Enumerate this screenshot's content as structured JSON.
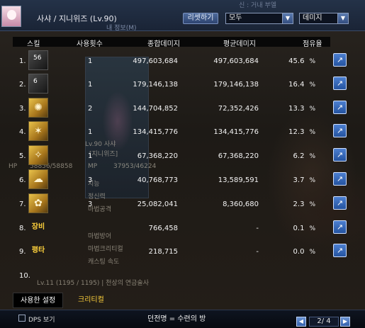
{
  "window": {
    "character_name": "사샤 / 지니위즈 (Lv.90)",
    "subtitle": "내 정보(M)",
    "top_hint": "신 : 거내 부엘",
    "reset_label": "리셋하기",
    "filter_dropdown": "모두",
    "metric_dropdown": "데미지"
  },
  "columns": {
    "skill": "스킬",
    "uses": "사용횟수",
    "total": "종합데미지",
    "average": "평균데미지",
    "share": "점유율"
  },
  "rows": [
    {
      "num": "1.",
      "icon": "skill-icon-1",
      "level": "56",
      "uses": "1",
      "total": "497,603,684",
      "average": "497,603,684",
      "share": "45.6",
      "unit": "%"
    },
    {
      "num": "2.",
      "icon": "skill-icon-2",
      "level": "6",
      "uses": "1",
      "total": "179,146,138",
      "average": "179,146,138",
      "share": "16.4",
      "unit": "%"
    },
    {
      "num": "3.",
      "icon": "skill-icon-3",
      "level": "",
      "uses": "2",
      "total": "144,704,852",
      "average": "72,352,426",
      "share": "13.3",
      "unit": "%"
    },
    {
      "num": "4.",
      "icon": "skill-icon-4",
      "level": "",
      "uses": "1",
      "total": "134,415,776",
      "average": "134,415,776",
      "share": "12.3",
      "unit": "%"
    },
    {
      "num": "5.",
      "icon": "skill-icon-5",
      "level": "",
      "uses": "1",
      "total": "67,368,220",
      "average": "67,368,220",
      "share": "6.2",
      "unit": "%"
    },
    {
      "num": "6.",
      "icon": "skill-icon-6",
      "level": "",
      "uses": "3",
      "total": "40,768,773",
      "average": "13,589,591",
      "share": "3.7",
      "unit": "%"
    },
    {
      "num": "7.",
      "icon": "skill-icon-7",
      "level": "",
      "uses": "3",
      "total": "25,082,041",
      "average": "8,360,680",
      "share": "2.3",
      "unit": "%"
    },
    {
      "num": "8.",
      "icon": "text",
      "icon_text": "장비",
      "level": "",
      "uses": "",
      "total": "766,458",
      "average": "-",
      "share": "0.1",
      "unit": "%"
    },
    {
      "num": "9.",
      "icon": "text",
      "icon_text": "평타",
      "level": "",
      "uses": "",
      "total": "218,715",
      "average": "-",
      "share": "0.0",
      "unit": "%"
    },
    {
      "num": "10.",
      "icon": "none",
      "icon_text": "",
      "level": "",
      "uses": "",
      "total": "",
      "average": "",
      "share": "",
      "unit": ""
    }
  ],
  "background_stats": {
    "hp": "HP",
    "hp_value": "58856/58858",
    "mp": "MP",
    "mp_value": "37953/46224",
    "stat1": "지능",
    "stat2": "정신력",
    "stat3": "마법공격",
    "stat4": "마법방어",
    "stat5": "마법크리티컬",
    "stat6": "캐스팅 속도",
    "char_level": "Lv.90 사샤",
    "char_class": "[지니위즈]",
    "footer_info": "Lv.11 (1195 / 1195) | 천상의 연금술사"
  },
  "tabs": {
    "used_settings": "사용한 설정",
    "critical": "크리티컬"
  },
  "footer": {
    "dps_label": "DPS 보기",
    "dungeon_label": "던전명 = 수련의 방",
    "page": "2/ 4"
  },
  "colors": {
    "accent_blue": "#3462ad",
    "gold": "#ffd23c",
    "header_bg": "#080808"
  }
}
